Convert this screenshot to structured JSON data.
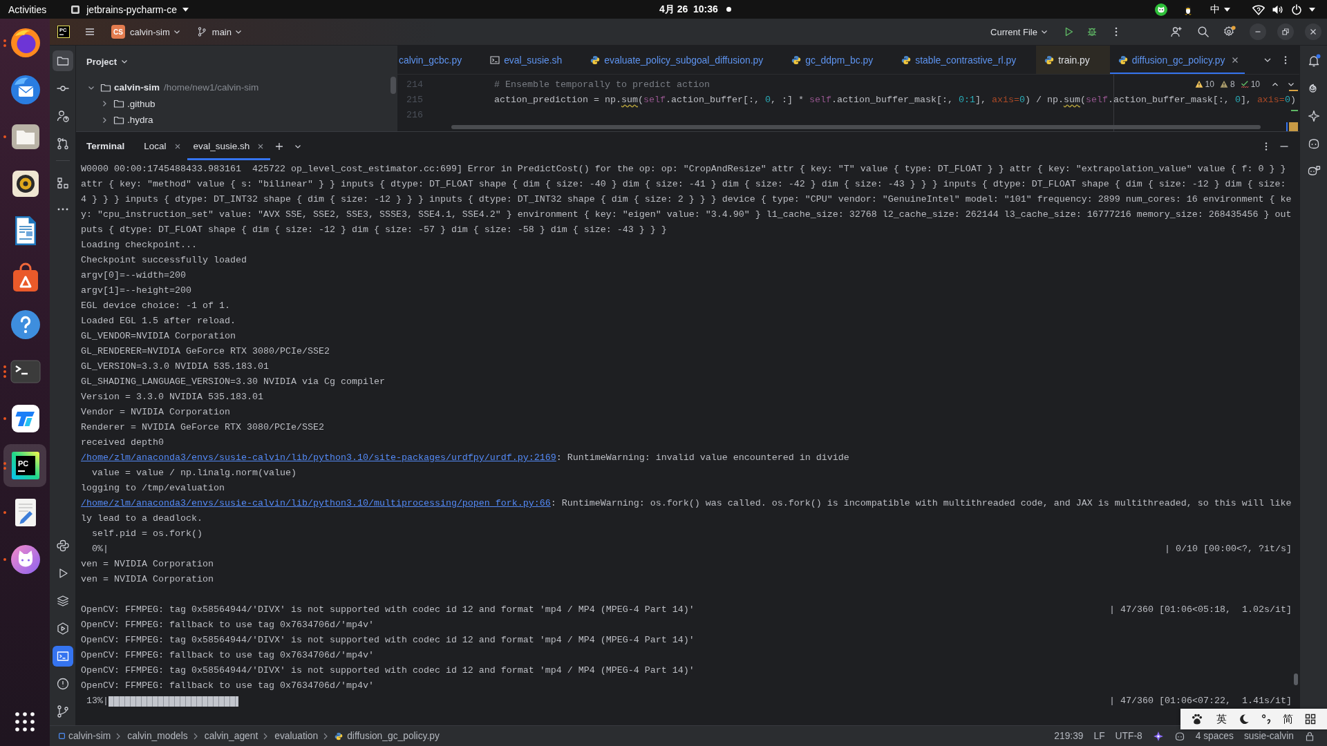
{
  "top_bar": {
    "activities": "Activities",
    "app_name": "jetbrains-pycharm-ce",
    "clock": "4月 26  10:36",
    "notification": true,
    "input_method": "中"
  },
  "dock": {
    "items": [
      {
        "kind": "browser",
        "focused": false,
        "window_dots": [
          {
            "lit": true
          },
          {
            "lit": true
          }
        ]
      },
      {
        "kind": "mail",
        "focused": false
      },
      {
        "kind": "files",
        "focused": false,
        "window_dots": [
          {
            "lit": true
          }
        ]
      },
      {
        "kind": "music",
        "focused": false
      },
      {
        "kind": "writer",
        "focused": false
      },
      {
        "kind": "store",
        "focused": false
      },
      {
        "kind": "help",
        "focused": false
      },
      {
        "kind": "terminal",
        "focused": false,
        "window_dots": [
          {
            "lit": true
          },
          {
            "lit": true
          },
          {
            "lit": true
          }
        ]
      },
      {
        "kind": "remote",
        "focused": false,
        "window_dots": [
          {
            "lit": true
          }
        ]
      },
      {
        "kind": "ide",
        "focused": true,
        "logo_text": "PC",
        "window_dots": [
          {
            "lit": true
          },
          {
            "lit": true
          }
        ]
      },
      {
        "kind": "editor",
        "focused": false,
        "window_dots": [
          {
            "lit": true
          }
        ]
      },
      {
        "kind": "cat",
        "focused": false,
        "window_dots": [
          {
            "lit": true
          }
        ]
      }
    ]
  },
  "ide_header": {
    "logo_text": "PC",
    "project_badge": "CS",
    "project": "calvin-sim",
    "branch": "main",
    "run_config": "Current File",
    "settings_update": true
  },
  "left_toolbar": {
    "top": [
      {
        "kind": "project",
        "selected": true
      },
      {
        "kind": "commit",
        "selected": false
      },
      {
        "kind": "collab",
        "selected": false
      },
      {
        "kind": "pull_requests",
        "selected": false
      }
    ],
    "middle": [
      {
        "kind": "structure",
        "selected": false
      },
      {
        "kind": "more",
        "selected": false
      }
    ],
    "bottom": [
      {
        "kind": "python_console",
        "selected": false
      },
      {
        "kind": "run",
        "selected": false
      },
      {
        "kind": "packages",
        "selected": false
      },
      {
        "kind": "services",
        "selected": false
      },
      {
        "kind": "terminal",
        "selected": true
      },
      {
        "kind": "problems",
        "selected": false
      },
      {
        "kind": "git",
        "selected": false
      }
    ]
  },
  "right_toolbar": [
    {
      "kind": "bell",
      "badge": true
    },
    {
      "kind": "spiral"
    },
    {
      "kind": "sparkle"
    },
    {
      "kind": "robot"
    },
    {
      "kind": "robot_chat"
    }
  ],
  "project_panel": {
    "title": "Project",
    "tree": [
      {
        "name": "calvin-sim",
        "path": "/home/new1/calvin-sim",
        "expanded": true,
        "children": [
          {
            "name": ".github",
            "expanded": false
          },
          {
            "name": ".hydra",
            "expanded": false
          }
        ]
      }
    ]
  },
  "editor": {
    "tabs": [
      {
        "label": "calvin_gcbc.py",
        "modified": true,
        "selected": false
      },
      {
        "label": "eval_susie.sh",
        "kind": "shell",
        "modified": true,
        "selected": false
      },
      {
        "label": "evaluate_policy_subgoal_diffusion.py",
        "kind": "python",
        "modified": true,
        "selected": false
      },
      {
        "label": "gc_ddpm_bc.py",
        "kind": "python",
        "modified": true,
        "selected": false
      },
      {
        "label": "stable_contrastive_rl.py",
        "kind": "python",
        "modified": true,
        "selected": false
      },
      {
        "label": "train.py",
        "kind": "python",
        "modified": false,
        "selected": false,
        "color": "#2d2a24"
      },
      {
        "label": "diffusion_gc_policy.py",
        "kind": "python",
        "modified": true,
        "selected": true
      }
    ],
    "inspections": {
      "warnings": "10",
      "weak_warnings": "8",
      "typos": "10"
    },
    "lines": [
      {
        "number": "214",
        "tokens": [
          {
            "kind": "comment",
            "text": "# Ensemble temporally to predict action"
          }
        ]
      },
      {
        "number": "215",
        "tokens": [
          {
            "kind": "plain",
            "text": "action_prediction = np."
          },
          {
            "kind": "typo",
            "text": "sum"
          },
          {
            "kind": "plain",
            "text": "("
          },
          {
            "kind": "self",
            "text": "self"
          },
          {
            "kind": "plain",
            "text": ".action_buffer[:, "
          },
          {
            "kind": "number",
            "text": "0"
          },
          {
            "kind": "plain",
            "text": ", :] * "
          },
          {
            "kind": "self",
            "text": "self"
          },
          {
            "kind": "plain",
            "text": ".action_buffer_mask[:, "
          },
          {
            "kind": "number",
            "text": "0:1"
          },
          {
            "kind": "plain",
            "text": "], "
          },
          {
            "kind": "param",
            "text": "axis="
          },
          {
            "kind": "number",
            "text": "0"
          },
          {
            "kind": "plain",
            "text": ") / np."
          },
          {
            "kind": "typo",
            "text": "sum"
          },
          {
            "kind": "plain",
            "text": "("
          },
          {
            "kind": "self",
            "text": "self"
          },
          {
            "kind": "plain",
            "text": ".action_buffer_mask[:, "
          },
          {
            "kind": "number",
            "text": "0"
          },
          {
            "kind": "plain",
            "text": "], "
          },
          {
            "kind": "param",
            "text": "axis="
          },
          {
            "kind": "number",
            "text": "0"
          },
          {
            "kind": "plain",
            "text": ")"
          }
        ]
      },
      {
        "number": "216"
      }
    ]
  },
  "terminal": {
    "title": "Terminal",
    "tabs": [
      {
        "label": "Local",
        "selected": false
      },
      {
        "label": "eval_susie.sh",
        "selected": true
      }
    ],
    "lines": [
      {
        "kind": "text",
        "text": "W0000 00:00:1745488433.983161  425722 op_level_cost_estimator.cc:699] Error in PredictCost() for the op: op: \"CropAndResize\" attr { key: \"T\" value { type: DT_FLOAT } } attr { key: \"extrapolation_value\" value { f: 0 } }"
      },
      {
        "kind": "text",
        "text": "attr { key: \"method\" value { s: \"bilinear\" } } inputs { dtype: DT_FLOAT shape { dim { size: -40 } dim { size: -41 } dim { size: -42 } dim { size: -43 } } } inputs { dtype: DT_FLOAT shape { dim { size: -12 } dim { size:"
      },
      {
        "kind": "text",
        "text": "4 } } } inputs { dtype: DT_INT32 shape { dim { size: -12 } } } inputs { dtype: DT_INT32 shape { dim { size: 2 } } } device { type: \"CPU\" vendor: \"GenuineIntel\" model: \"101\" frequency: 2899 num_cores: 16 environment { ke"
      },
      {
        "kind": "text",
        "text": "y: \"cpu_instruction_set\" value: \"AVX SSE, SSE2, SSE3, SSSE3, SSE4.1, SSE4.2\" } environment { key: \"eigen\" value: \"3.4.90\" } l1_cache_size: 32768 l2_cache_size: 262144 l3_cache_size: 16777216 memory_size: 268435456 } out"
      },
      {
        "kind": "text",
        "text": "puts { dtype: DT_FLOAT shape { dim { size: -12 } dim { size: -57 } dim { size: -58 } dim { size: -43 } } }"
      },
      {
        "kind": "text",
        "text": "Loading checkpoint..."
      },
      {
        "kind": "text",
        "text": "Checkpoint successfully loaded"
      },
      {
        "kind": "text",
        "text": "argv[0]=--width=200"
      },
      {
        "kind": "text",
        "text": "argv[1]=--height=200"
      },
      {
        "kind": "text",
        "text": "EGL device choice: -1 of 1."
      },
      {
        "kind": "text",
        "text": "Loaded EGL 1.5 after reload."
      },
      {
        "kind": "text",
        "text": "GL_VENDOR=NVIDIA Corporation"
      },
      {
        "kind": "text",
        "text": "GL_RENDERER=NVIDIA GeForce RTX 3080/PCIe/SSE2"
      },
      {
        "kind": "text",
        "text": "GL_VERSION=3.3.0 NVIDIA 535.183.01"
      },
      {
        "kind": "text",
        "text": "GL_SHADING_LANGUAGE_VERSION=3.30 NVIDIA via Cg compiler"
      },
      {
        "kind": "text",
        "text": "Version = 3.3.0 NVIDIA 535.183.01"
      },
      {
        "kind": "text",
        "text": "Vendor = NVIDIA Corporation"
      },
      {
        "kind": "text",
        "text": "Renderer = NVIDIA GeForce RTX 3080/PCIe/SSE2"
      },
      {
        "kind": "text",
        "text": "received depth0"
      },
      {
        "kind": "link",
        "link": "/home/zlm/anaconda3/envs/susie-calvin/lib/python3.10/site-packages/urdfpy/urdf.py:2169",
        "text": ": RuntimeWarning: invalid value encountered in divide"
      },
      {
        "kind": "text",
        "text": "  value = value / np.linalg.norm(value)"
      },
      {
        "kind": "text",
        "text": "logging to /tmp/evaluation"
      },
      {
        "kind": "link",
        "link": "/home/zlm/anaconda3/envs/susie-calvin/lib/python3.10/multiprocessing/popen_fork.py:66",
        "text": ": RuntimeWarning: os.fork() was called. os.fork() is incompatible with multithreaded code, and JAX is multithreaded, so this will like"
      },
      {
        "kind": "text",
        "text": "ly lead to a deadlock."
      },
      {
        "kind": "text",
        "text": "  self.pid = os.fork()"
      },
      {
        "kind": "text",
        "text": "  0%|",
        "status": "| 0/10 [00:00<?, ?it/s]"
      },
      {
        "kind": "text",
        "text": "ven = NVIDIA Corporation"
      },
      {
        "kind": "text",
        "text": "ven = NVIDIA Corporation"
      },
      {
        "kind": "blank"
      },
      {
        "kind": "text",
        "text": "OpenCV: FFMPEG: tag 0x58564944/'DIVX' is not supported with codec id 12 and format 'mp4 / MP4 (MPEG-4 Part 14)'",
        "status": "| 47/360 [01:06<05:18,  1.02s/it]"
      },
      {
        "kind": "text",
        "text": "OpenCV: FFMPEG: fallback to use tag 0x7634706d/'mp4v'"
      },
      {
        "kind": "text",
        "text": "OpenCV: FFMPEG: tag 0x58564944/'DIVX' is not supported with codec id 12 and format 'mp4 / MP4 (MPEG-4 Part 14)'"
      },
      {
        "kind": "text",
        "text": "OpenCV: FFMPEG: fallback to use tag 0x7634706d/'mp4v'"
      },
      {
        "kind": "text",
        "text": "OpenCV: FFMPEG: tag 0x58564944/'DIVX' is not supported with codec id 12 and format 'mp4 / MP4 (MPEG-4 Part 14)'"
      },
      {
        "kind": "text",
        "text": "OpenCV: FFMPEG: fallback to use tag 0x7634706d/'mp4v'"
      },
      {
        "kind": "bar",
        "text": " 13%|",
        "level": 0.13,
        "status": "| 47/360 [01:06<07:22,  1.41s/it]"
      }
    ]
  },
  "status_bar": {
    "breadcrumbs": [
      {
        "label": "calvin-sim",
        "kind": "module"
      },
      {
        "label": "calvin_models"
      },
      {
        "label": "calvin_agent"
      },
      {
        "label": "evaluation"
      },
      {
        "label": "diffusion_gc_policy.py",
        "kind": "python"
      }
    ],
    "position": "219:39",
    "line_separator": "LF",
    "encoding": "UTF-8",
    "indent": "4 spaces",
    "interpreter": "susie-calvin"
  },
  "input_toolbar": {
    "language": "英",
    "script": "简"
  }
}
